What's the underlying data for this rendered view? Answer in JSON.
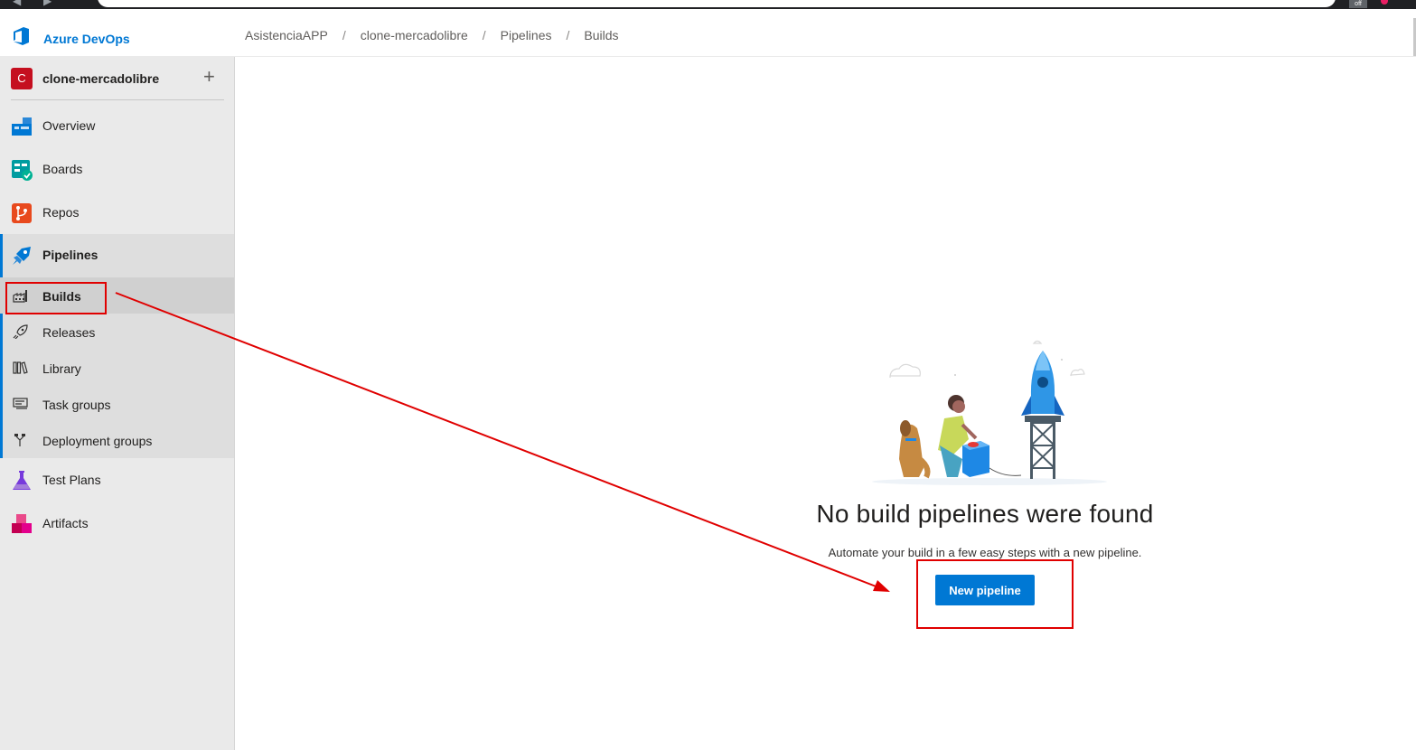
{
  "header": {
    "brand": "Azure DevOps",
    "breadcrumb": [
      "AsistenciaAPP",
      "clone-mercadolibre",
      "Pipelines",
      "Builds"
    ],
    "separator": "/"
  },
  "project": {
    "avatar_letter": "C",
    "name": "clone-mercadolibre",
    "add_symbol": "+"
  },
  "nav": {
    "overview": "Overview",
    "boards": "Boards",
    "repos": "Repos",
    "pipelines": "Pipelines",
    "test_plans": "Test Plans",
    "artifacts": "Artifacts"
  },
  "pipelines_sub": {
    "builds": "Builds",
    "releases": "Releases",
    "library": "Library",
    "task_groups": "Task groups",
    "deployment_groups": "Deployment groups"
  },
  "main": {
    "empty_title": "No build pipelines were found",
    "empty_description": "Automate your build in a few easy steps with a new pipeline.",
    "new_pipeline_label": "New pipeline"
  },
  "browser": {
    "extension_badge": "off"
  },
  "colors": {
    "accent": "#0078d4",
    "annotation": "#e00000",
    "project_avatar": "#c50f1f"
  }
}
